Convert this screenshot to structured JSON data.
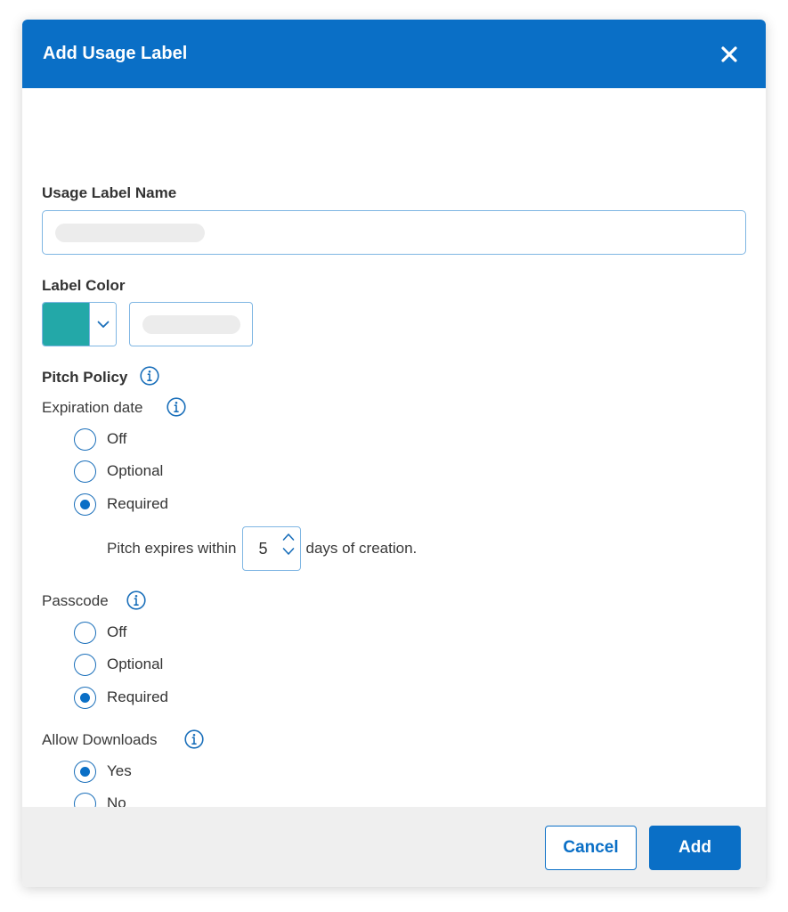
{
  "dialog": {
    "title": "Add Usage Label",
    "close_icon": "close-icon"
  },
  "name_field": {
    "label": "Usage Label Name",
    "value": ""
  },
  "color_field": {
    "label": "Label Color",
    "selected_color": "#23a8a8",
    "hex_value": ""
  },
  "pitch_policy": {
    "label": "Pitch Policy",
    "expiration": {
      "label": "Expiration date",
      "options": [
        "Off",
        "Optional",
        "Required"
      ],
      "selected": "Required",
      "expires_prefix": "Pitch expires within",
      "days_value": "5",
      "expires_suffix": "days of creation."
    },
    "passcode": {
      "label": "Passcode",
      "options": [
        "Off",
        "Optional",
        "Required"
      ],
      "selected": "Required"
    },
    "downloads": {
      "label": "Allow Downloads",
      "options": [
        "Yes",
        "No"
      ],
      "selected": "Yes"
    }
  },
  "footer": {
    "cancel_label": "Cancel",
    "add_label": "Add"
  },
  "colors": {
    "accent": "#0a6fc6",
    "footer_bg": "#efefef"
  }
}
